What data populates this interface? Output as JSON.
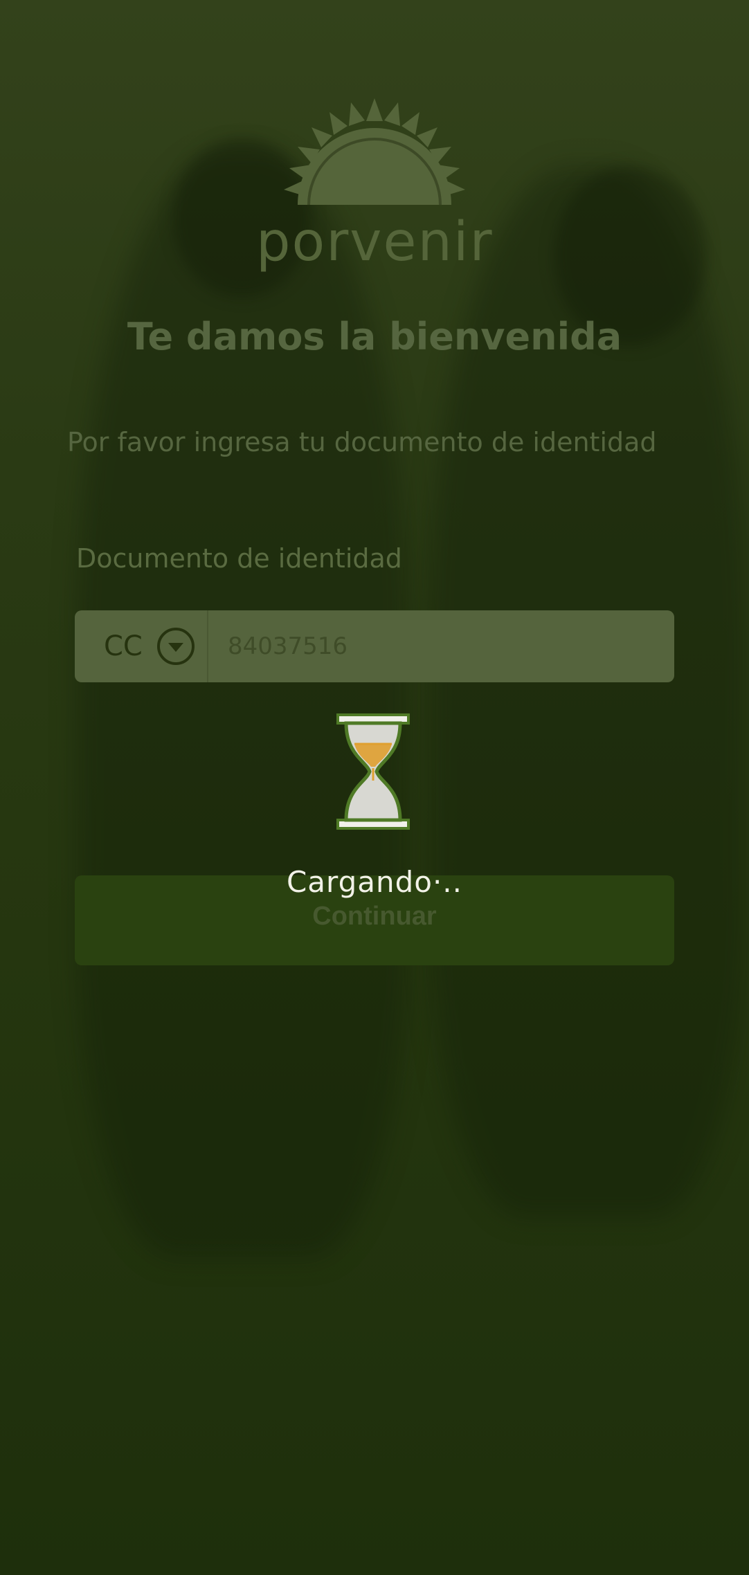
{
  "brand": {
    "logo_text": "porvenir"
  },
  "welcome": {
    "title": "Te damos la bienvenida",
    "subtitle": "Por favor ingresa tu documento de identidad"
  },
  "document_field": {
    "label": "Documento de identidad",
    "type_value": "CC",
    "number_value": "84037516"
  },
  "actions": {
    "continue_label": "Continuar"
  },
  "loading": {
    "text": "Cargando·..",
    "icon": "hourglass-icon"
  },
  "colors": {
    "background": "#2a3a14",
    "overlay_text": "#566640",
    "button": "#2a4210",
    "hourglass_sand": "#e0a030"
  }
}
